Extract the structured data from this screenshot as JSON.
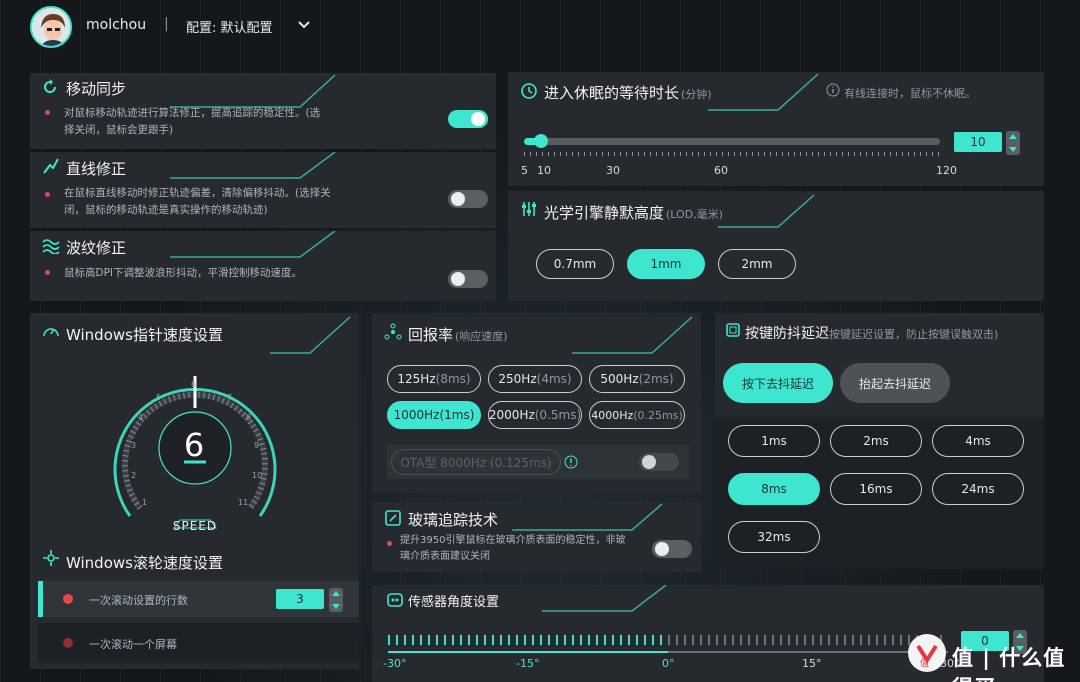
{
  "header": {
    "username": "molchou",
    "separator": "|",
    "profile": "配置: 默认配置"
  },
  "move_sync": {
    "title": "移动同步",
    "desc": "对鼠标移动轨迹进行算法修正，提高追踪的稳定性。(选择关闭，鼠标会更跟手)",
    "enabled": true
  },
  "line_fix": {
    "title": "直线修正",
    "desc": "在鼠标直线移动时修正轨迹偏差，清除偏移抖动。(选择关闭，鼠标的移动轨迹是真实操作的移动轨迹)",
    "enabled": false
  },
  "ripple_fix": {
    "title": "波纹修正",
    "desc": "鼠标高DPI下调整波浪形抖动，平滑控制移动速度。",
    "enabled": false
  },
  "sleep": {
    "title": "进入休眠的等待时长",
    "unit": "(分钟)",
    "note": "有线连接时，鼠标不休眠。",
    "value": "10",
    "ticks": [
      "5",
      "10",
      "30",
      "60",
      "120"
    ]
  },
  "lod": {
    "title": "光学引擎静默高度",
    "unit": "(LOD,毫米)",
    "options": [
      "0.7mm",
      "1mm",
      "2mm"
    ],
    "selected": "1mm"
  },
  "pointer": {
    "title": "Windows指针速度设置",
    "value": "6",
    "caption": "SPEED",
    "dial_labels": [
      "1",
      "2",
      "3",
      "4",
      "5",
      "6",
      "7",
      "8",
      "9",
      "10",
      "11"
    ]
  },
  "report": {
    "title": "回报率",
    "subtitle": "(响应速度)",
    "options": [
      {
        "main": "125Hz",
        "unit": "(8ms)"
      },
      {
        "main": "250Hz",
        "unit": "(4ms)"
      },
      {
        "main": "500Hz",
        "unit": "(2ms)"
      },
      {
        "main": "1000Hz",
        "unit": "(1ms)"
      },
      {
        "main": "2000Hz",
        "unit": "(0.5ms)"
      },
      {
        "main": "4000Hz",
        "unit": "(0.25ms)"
      }
    ],
    "selected": "1000Hz",
    "ota": "OTA型 8000Hz (0.125ms)"
  },
  "debounce": {
    "title": "按键防抖延迟",
    "subtitle": "按键延迟设置，防止按键误触双击)",
    "tabs": [
      "按下去抖延迟",
      "抬起去抖延迟"
    ],
    "options": [
      "1ms",
      "2ms",
      "4ms",
      "8ms",
      "16ms",
      "24ms",
      "32ms"
    ],
    "selected": "8ms"
  },
  "glass": {
    "title": "玻璃追踪技术",
    "desc": "提升3950引擎鼠标在玻璃介质表面的稳定性，非玻璃介质表面建议关闭",
    "enabled": false
  },
  "scroll": {
    "title": "Windows滚轮速度设置",
    "rows": [
      {
        "label": "一次滚动设置的行数",
        "value": "3"
      },
      {
        "label": "一次滚动一个屏幕"
      }
    ]
  },
  "sensor": {
    "title": "传感器角度设置",
    "value": "0",
    "ticks": [
      "-30°",
      "-15°",
      "0°",
      "15°",
      "30°"
    ]
  },
  "watermark": "值 | 什么值得买",
  "colors": {
    "accent": "#3fe6cf",
    "panel": "#262a2e",
    "red_dot": "#e5484d"
  }
}
